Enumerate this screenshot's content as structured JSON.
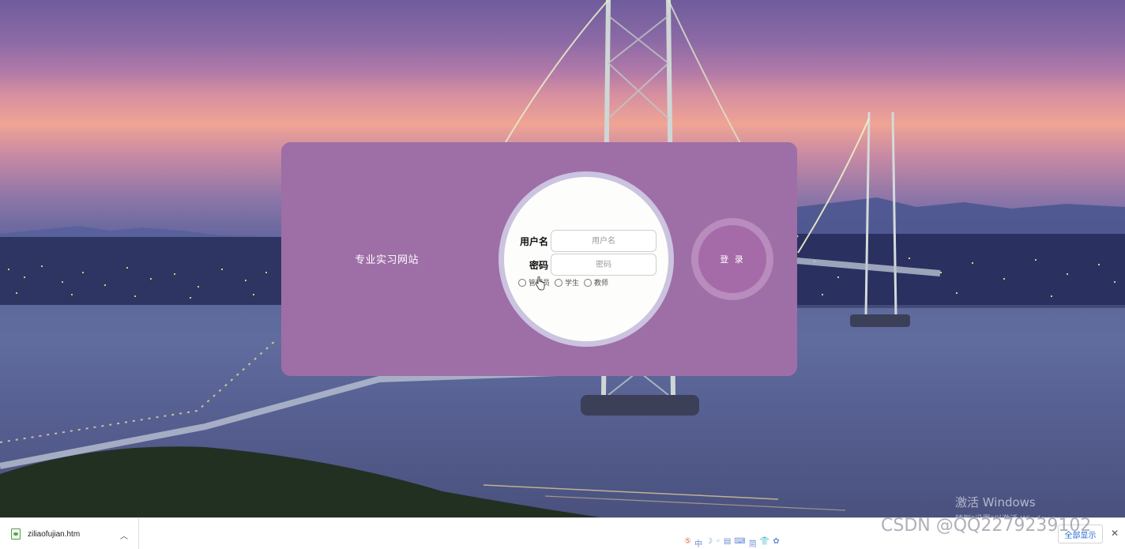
{
  "scene": {
    "description_icon": "bridge-city-sunset-background"
  },
  "login": {
    "site_title": "专业实习网站",
    "username_label": "用户名",
    "username_placeholder": "用户名",
    "password_label": "密码",
    "password_placeholder": "密码",
    "roles": [
      "管理员",
      "学生",
      "教师"
    ],
    "login_button": "登 录"
  },
  "watermarks": {
    "windows_line1": "激活 Windows",
    "windows_line2": "转到\"设置\"以激活 Windows。",
    "csdn": "CSDN @QQ2279239102"
  },
  "download_bar": {
    "file_name": "ziliaofujian.htm",
    "show_all": "全部显示",
    "ime_items": [
      "⑤",
      "中",
      "☽",
      "◦",
      "▤",
      "⌨",
      "简",
      "👕",
      "✿"
    ]
  },
  "colors": {
    "card_left": "#9e6ea6",
    "card_right": "#785ca8",
    "login_button": "#a46ba8"
  }
}
